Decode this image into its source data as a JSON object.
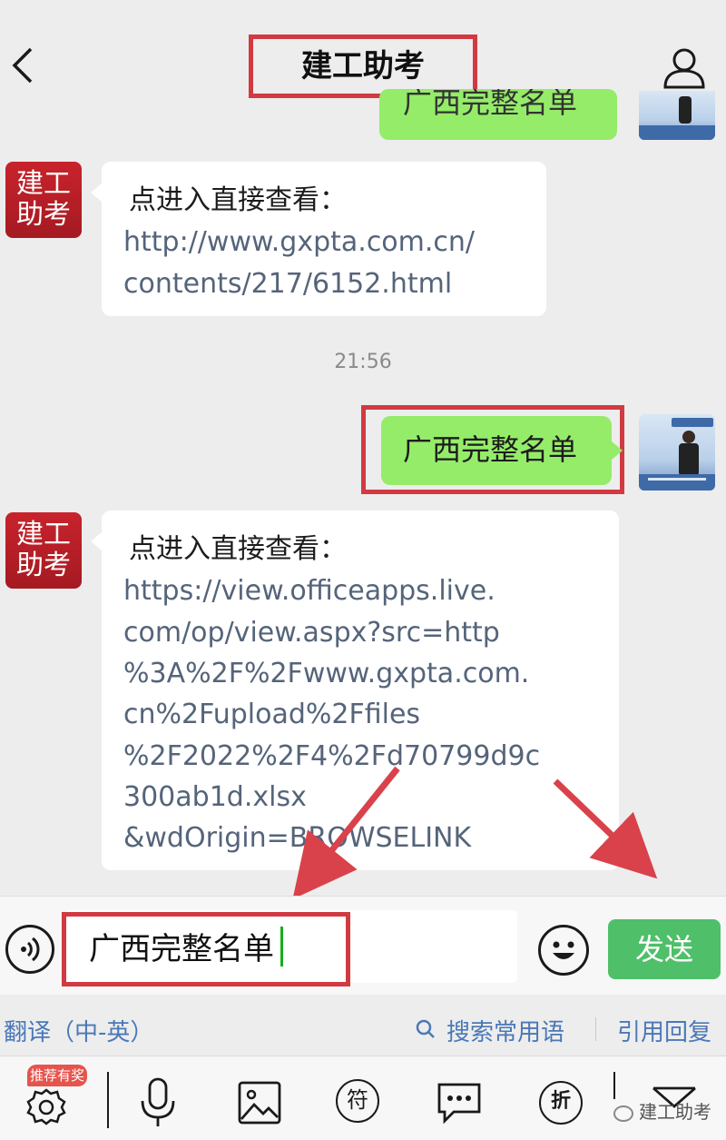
{
  "header": {
    "title": "建工助考"
  },
  "messages": {
    "top_partial_text": "广西完整名单",
    "msg1": {
      "sender_avatar_text": [
        "建工",
        "助考"
      ],
      "prefix": "点进入直接查看：",
      "link_lines": [
        "http://www.gxpta.com.cn/",
        "contents/217/6152.html"
      ]
    },
    "timestamp": "21:56",
    "msg2": {
      "text": "广西完整名单"
    },
    "msg3": {
      "sender_avatar_text": [
        "建工",
        "助考"
      ],
      "prefix": "点进入直接查看：",
      "link_lines": [
        "https://view.officeapps.live.",
        "com/op/view.aspx?src=http",
        "%3A%2F%2Fwww.gxpta.com.",
        "cn%2Fupload%2Ffiles",
        "%2F2022%2F4%2Fd70799d9c",
        "300ab1d.xlsx",
        "&wdOrigin=BROWSELINK"
      ]
    }
  },
  "input": {
    "value": "广西完整名单",
    "send_label": "发送"
  },
  "quick_bar": {
    "translate": "翻译（中-英）",
    "search_phrases": "搜索常用语",
    "quote_reply": "引用回复"
  },
  "toolbar": {
    "badge": "推荐有奖",
    "symbol_label": "符",
    "discount_label": "折"
  },
  "watermark": "建工助考",
  "colors": {
    "accent_red": "#d23a42",
    "bubble_green": "#95ec69",
    "send_green": "#4fbf6a",
    "link_gray_blue": "#55647a",
    "quick_blue": "#4a78b8"
  }
}
